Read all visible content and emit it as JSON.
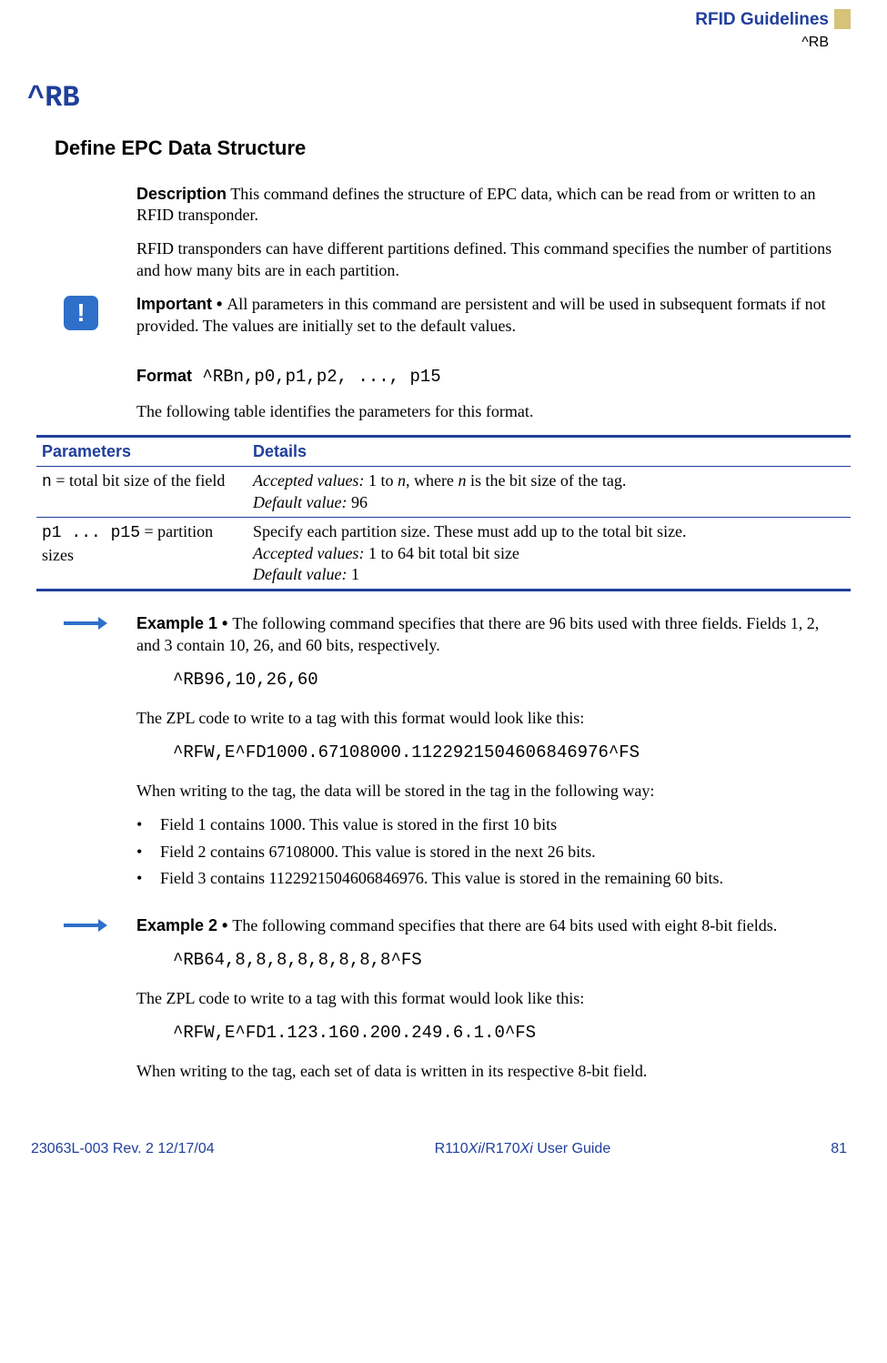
{
  "header": {
    "guide": "RFID Guidelines",
    "cmd": "^RB"
  },
  "title": "^RB",
  "subtitle": "Define EPC Data Structure",
  "desc_label": "Description",
  "desc_text": "  This command defines the structure of EPC data, which can be read from or written to an RFID transponder.",
  "desc_para2": "RFID transponders can have different partitions defined. This command specifies the number of partitions and how many bits are in each partition.",
  "important_label": "Important • ",
  "important_text": "All parameters in this command are persistent and will be used in subsequent formats if not provided. The values are initially set to the default values.",
  "format_label": "Format",
  "format_code": " ^RBn,p0,p1,p2, ..., p15",
  "format_intro": "The following table identifies the parameters for this format.",
  "table": {
    "h1": "Parameters",
    "h2": "Details",
    "r1": {
      "p_code": "n",
      "p_text": " = total bit size of the field",
      "d1a": "Accepted values:",
      "d1b": " 1 to ",
      "d1n": "n",
      "d1c": ", where ",
      "d1n2": "n",
      "d1d": " is the bit size of the tag.",
      "d2a": "Default value:",
      "d2b": " 96"
    },
    "r2": {
      "p_code": "p1 ... p15",
      "p_text": " = partition sizes",
      "d1": "Specify each partition size. These must add up to the total bit size.",
      "d2a": "Accepted values:",
      "d2b": " 1 to 64 bit total bit size",
      "d3a": "Default value:",
      "d3b": " 1"
    }
  },
  "ex1": {
    "label": "Example 1 • ",
    "text": "The following command specifies that there are 96 bits used with three fields. Fields 1, 2, and 3 contain 10, 26, and 60 bits, respectively.",
    "code1": "^RB96,10,26,60",
    "p2": "The ZPL code to write to a tag with this format would look like this:",
    "code2": "^RFW,E^FD1000.67108000.1122921504606846976^FS",
    "p3": "When writing to the tag, the data will be stored in the tag in the following way:",
    "b1": "Field 1 contains 1000. This value is stored in the first 10 bits",
    "b2": "Field 2 contains 67108000. This value is stored in the next 26 bits.",
    "b3": "Field 3 contains 1122921504606846976. This value is stored in the remaining 60 bits."
  },
  "ex2": {
    "label": "Example 2 • ",
    "text": "The following command specifies that there are 64 bits used with eight 8-bit fields.",
    "code1": "^RB64,8,8,8,8,8,8,8,8^FS",
    "p2": "The ZPL code to write to a tag with this format would look like this:",
    "code2": "^RFW,E^FD1.123.160.200.249.6.1.0^FS",
    "p3": "When writing to the tag, each set of data is written in its respective 8-bit field."
  },
  "footer": {
    "left": "23063L-003 Rev. 2    12/17/04",
    "center_a": "R110",
    "center_b": "Xi",
    "center_c": "/R170",
    "center_d": "Xi",
    "center_e": " User Guide",
    "right": "81"
  }
}
